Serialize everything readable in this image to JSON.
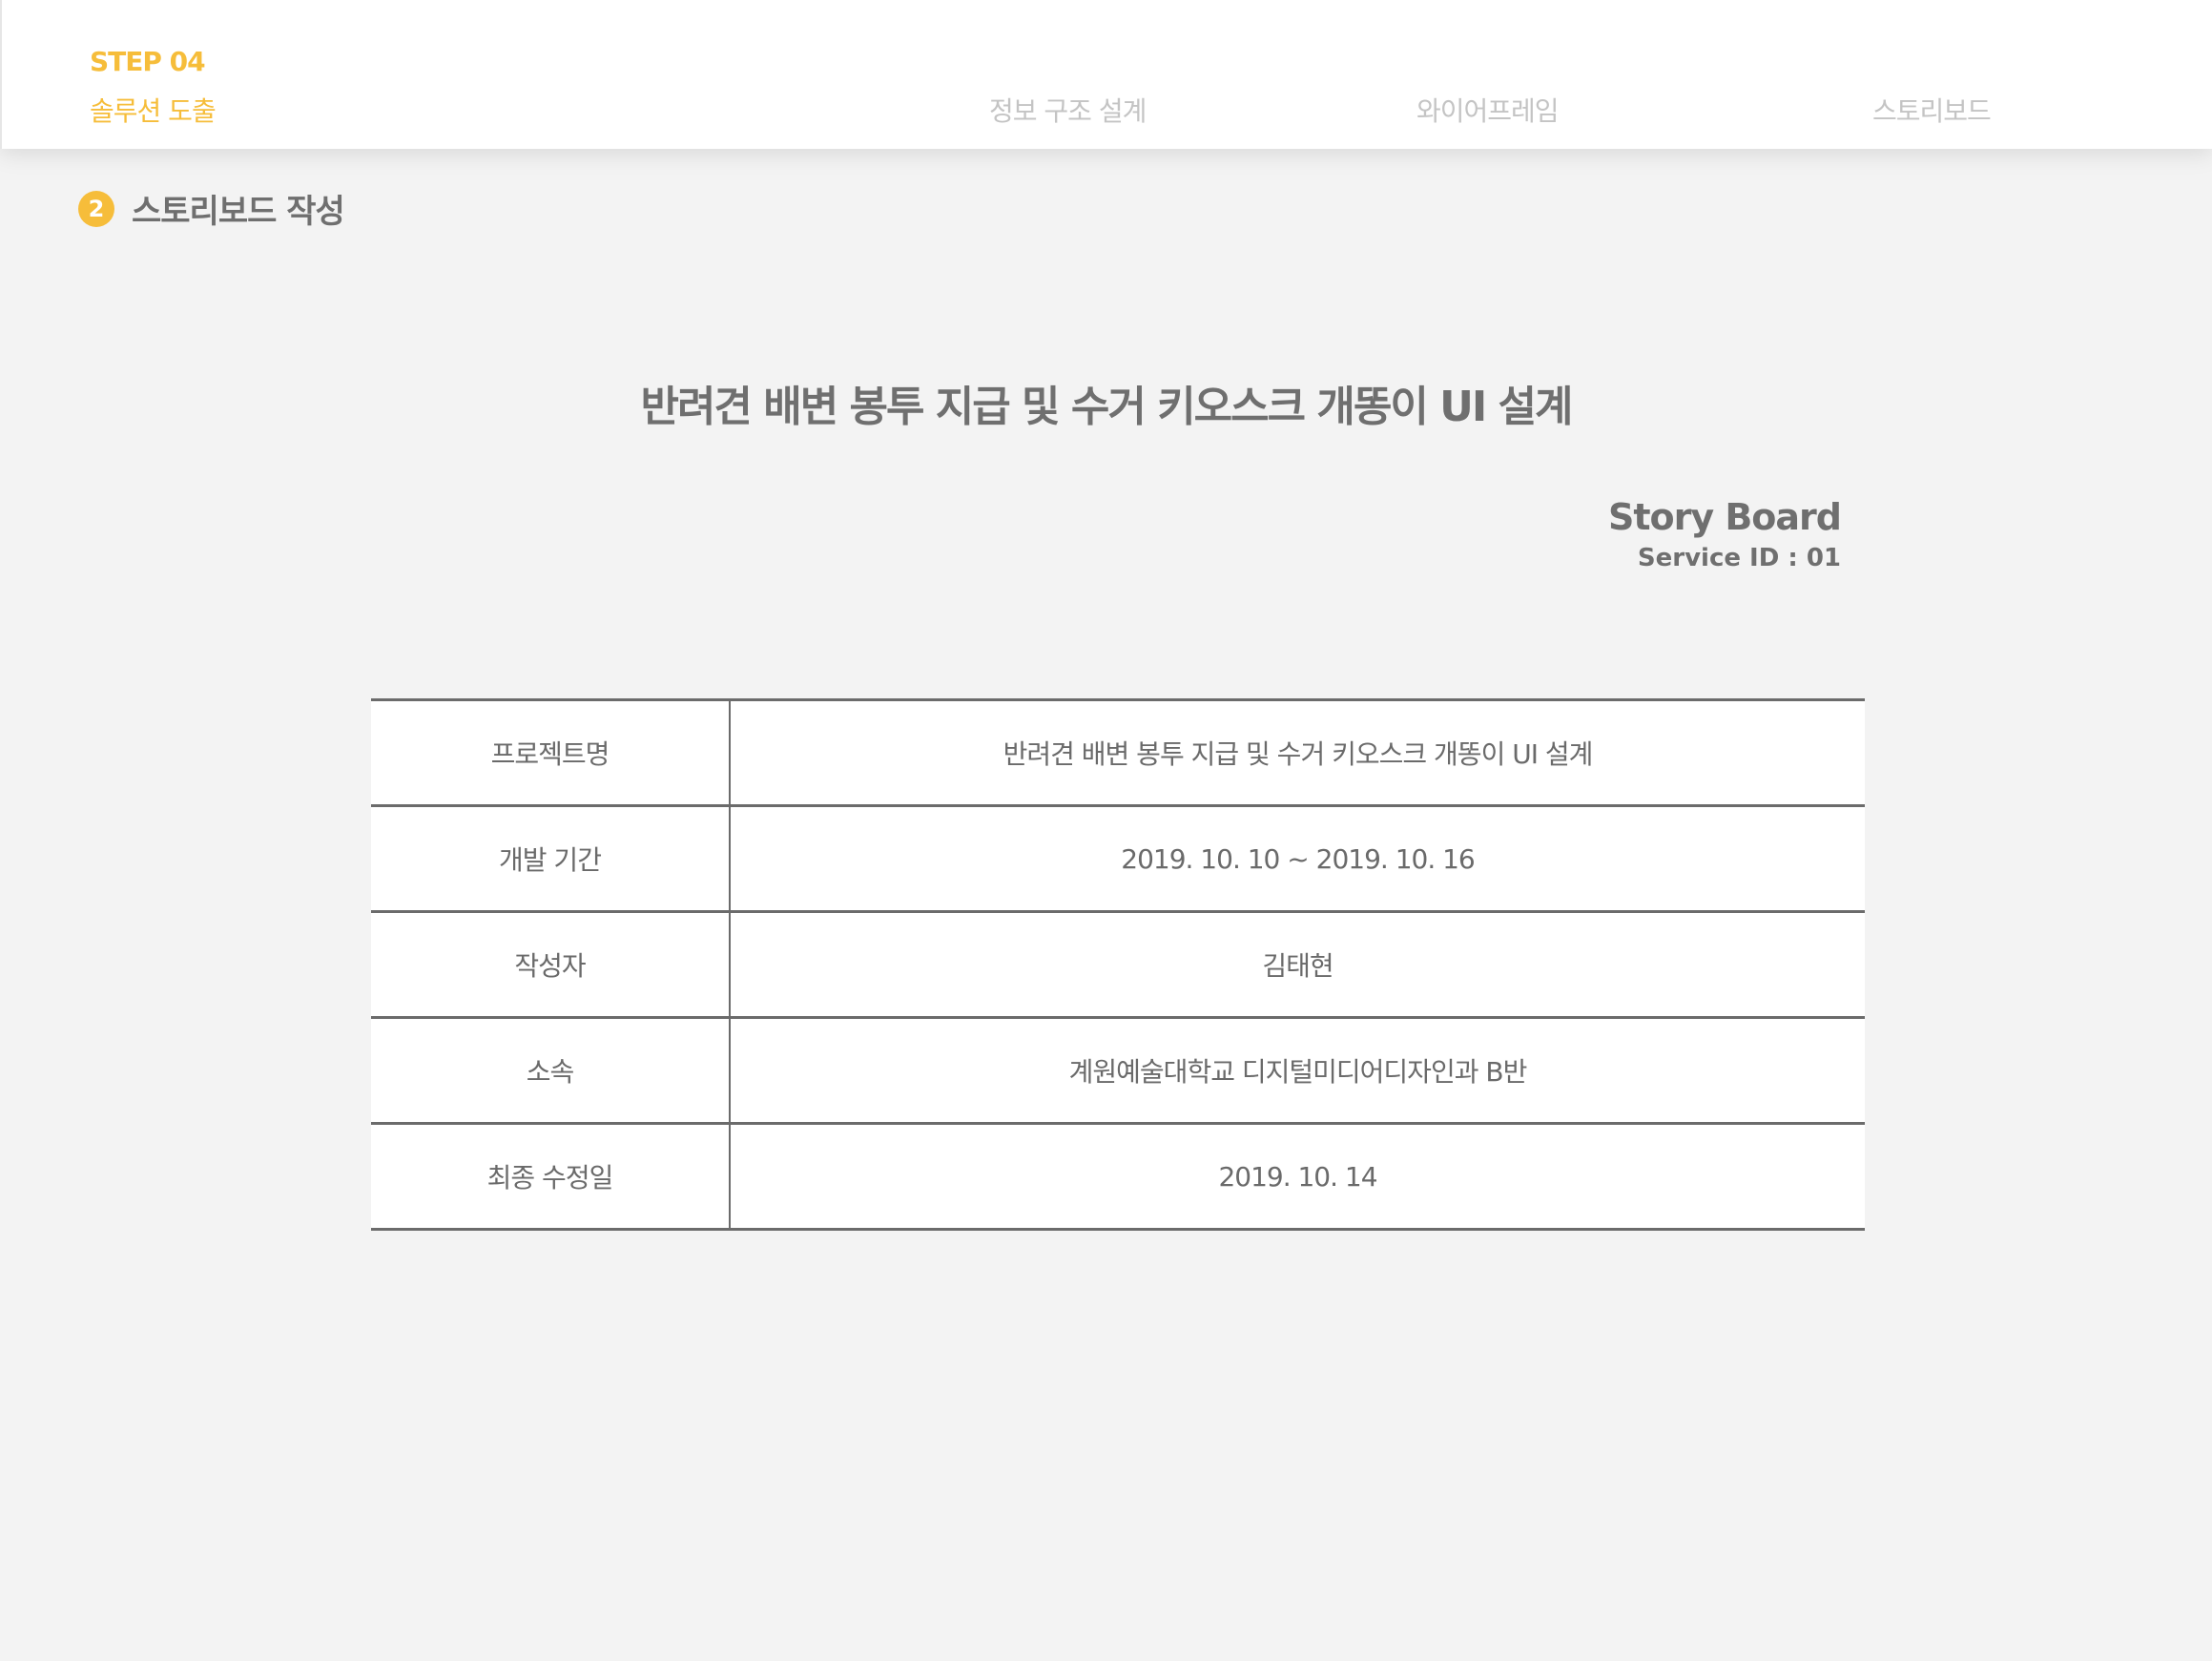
{
  "header": {
    "step": "STEP 04",
    "step_title": "솔루션 도출",
    "nav": [
      "정보 구조 설계",
      "와이어프레임",
      "스토리보드"
    ]
  },
  "section": {
    "number": "2",
    "title": "스토리보드 작성"
  },
  "doc": {
    "title": "반려견 배변 봉투 지급 및 수거 키오스크 개똥이 UI 설계",
    "storyboard_label": "Story Board",
    "service_id": "Service ID : 01"
  },
  "table": {
    "rows": [
      {
        "label": "프로젝트명",
        "value": "반려견 배변 봉투 지급 및 수거 키오스크 개똥이 UI 설계"
      },
      {
        "label": "개발 기간",
        "value": "2019. 10. 10 ~ 2019. 10. 16"
      },
      {
        "label": "작성자",
        "value": "김태현"
      },
      {
        "label": "소속",
        "value": "계원예술대학교 디지털미디어디자인과 B반"
      },
      {
        "label": "최종 수정일",
        "value": "2019. 10. 14"
      }
    ]
  },
  "colors": {
    "accent": "#f6bd3a",
    "text": "#6f6f6f",
    "nav_inactive": "#c4c4c4",
    "background": "#f3f3f3"
  }
}
